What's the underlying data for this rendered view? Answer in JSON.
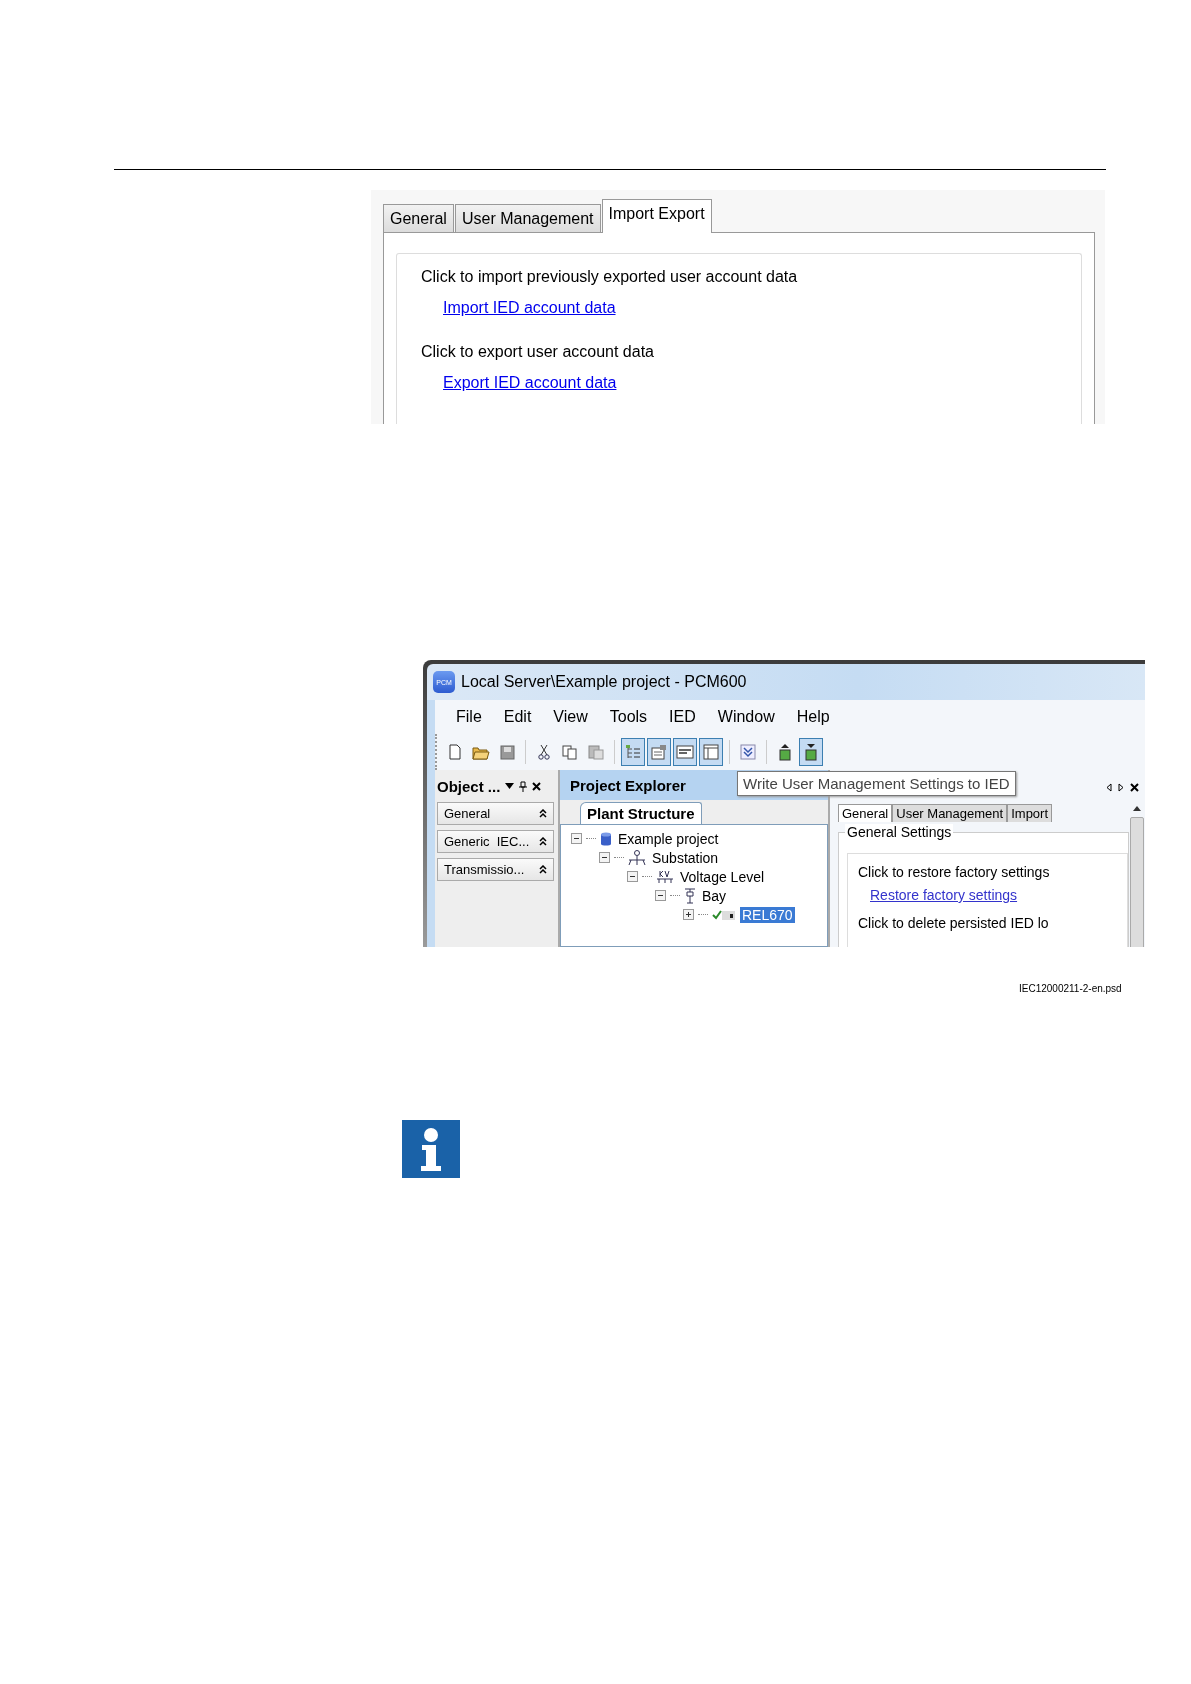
{
  "figure_1": {
    "tabs": [
      {
        "label": "General",
        "selected": false
      },
      {
        "label": "User Management",
        "selected": false
      },
      {
        "label": "Import Export",
        "selected": true
      }
    ],
    "sections": [
      {
        "text": "Click to import previously exported user account data",
        "link": "Import IED account data"
      },
      {
        "text": "Click to export user account data",
        "link": "Export IED account data"
      }
    ]
  },
  "figure_2": {
    "window": {
      "title": "Local Server\\Example project - PCM600",
      "logo": "PCM"
    },
    "menu": [
      "File",
      "Edit",
      "View",
      "Tools",
      "IED",
      "Window",
      "Help"
    ],
    "toolbar": [
      {
        "kind": "new",
        "pressed": false
      },
      {
        "kind": "open",
        "pressed": false
      },
      {
        "kind": "save",
        "pressed": false
      },
      {
        "kind": "sep"
      },
      {
        "kind": "cut",
        "pressed": false
      },
      {
        "kind": "copy",
        "pressed": false
      },
      {
        "kind": "paste",
        "pressed": false
      },
      {
        "kind": "sep"
      },
      {
        "kind": "tree",
        "pressed": true
      },
      {
        "kind": "props",
        "pressed": true
      },
      {
        "kind": "form",
        "pressed": true
      },
      {
        "kind": "window",
        "pressed": true
      },
      {
        "kind": "sep"
      },
      {
        "kind": "chevron",
        "pressed": false
      },
      {
        "kind": "sep"
      },
      {
        "kind": "read",
        "pressed": false
      },
      {
        "kind": "write",
        "pressed": true
      }
    ],
    "object_panel": {
      "title": "Object ...",
      "groups": [
        "General",
        "Generic  IEC...",
        "Transmissio..."
      ]
    },
    "project_explorer": {
      "title": "Project Explorer",
      "tab": "Plant Structure",
      "tree": [
        {
          "label": "Example project",
          "kind": "project",
          "expanded": true,
          "selected": false,
          "children": [
            {
              "label": "Substation",
              "kind": "substation",
              "expanded": true,
              "selected": false,
              "children": [
                {
                  "label": "Voltage Level",
                  "kind": "voltage",
                  "expanded": true,
                  "selected": false,
                  "children": [
                    {
                      "label": "Bay",
                      "kind": "bay",
                      "expanded": true,
                      "selected": false,
                      "children": [
                        {
                          "label": "REL670",
                          "kind": "ied",
                          "expanded": false,
                          "selected": true
                        }
                      ]
                    }
                  ]
                }
              ]
            }
          ]
        }
      ]
    },
    "editor": {
      "tabs": [
        {
          "label": "General",
          "selected": true
        },
        {
          "label": "User Management",
          "selected": false
        },
        {
          "label": "Import",
          "selected": false
        }
      ],
      "group_title": "General Settings",
      "lines": [
        {
          "kind": "text",
          "text": "Click to restore factory settings"
        },
        {
          "kind": "link",
          "text": "Restore factory settings"
        },
        {
          "kind": "text",
          "text": "Click to delete persisted IED lo"
        }
      ]
    },
    "tooltip": "Write User Management Settings to IED"
  },
  "caption": "IEC12000211-2-en.psd"
}
